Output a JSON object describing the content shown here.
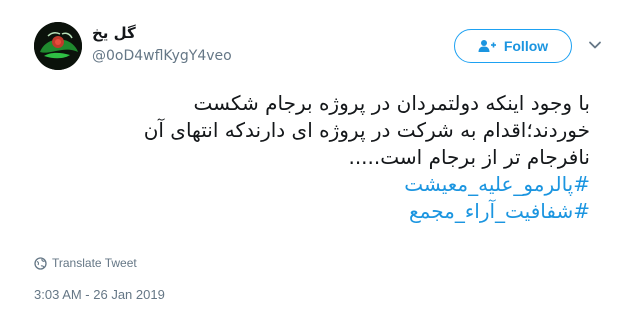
{
  "user": {
    "display_name": "گل یخ",
    "handle": "@0oD4wflKygY4veo",
    "avatar_icon": "profile-avatar"
  },
  "follow_button": {
    "label": "Follow",
    "icon": "follow-user-icon",
    "color": "#1da1f2"
  },
  "menu_icon": "chevron-down-icon",
  "tweet": {
    "lines": [
      "با وجود اینکه دولتمردان در پروژه برجام شکست",
      "خوردند؛اقدام به شرکت در پروژه ای دارندکه انتهای آن",
      "نافرجام تر از برجام است....."
    ],
    "hashtags": [
      "#پالرمو_علیه_معیشت",
      "#شفافیت_آراء_مجمع"
    ],
    "hashtag_color": "#1b95e0"
  },
  "translate": {
    "label": "Translate Tweet",
    "icon": "globe-icon"
  },
  "timestamp": "3:03 AM - 26 Jan 2019"
}
